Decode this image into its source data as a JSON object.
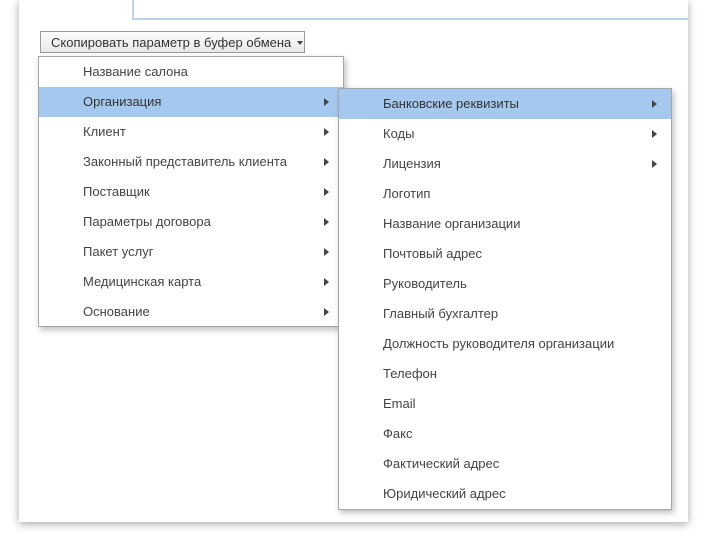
{
  "toolbar": {
    "copy_button_label": "Скопировать параметр в буфер обмена"
  },
  "main_menu": {
    "items": [
      {
        "label": "Название салона",
        "has_submenu": false,
        "highlighted": false
      },
      {
        "label": "Организация",
        "has_submenu": true,
        "highlighted": true
      },
      {
        "label": "Клиент",
        "has_submenu": true,
        "highlighted": false
      },
      {
        "label": "Законный представитель клиента",
        "has_submenu": true,
        "highlighted": false
      },
      {
        "label": "Поставщик",
        "has_submenu": true,
        "highlighted": false
      },
      {
        "label": "Параметры договора",
        "has_submenu": true,
        "highlighted": false
      },
      {
        "label": "Пакет услуг",
        "has_submenu": true,
        "highlighted": false
      },
      {
        "label": "Медицинская карта",
        "has_submenu": true,
        "highlighted": false
      },
      {
        "label": "Основание",
        "has_submenu": true,
        "highlighted": false
      }
    ]
  },
  "sub_menu": {
    "items": [
      {
        "label": "Банковские реквизиты",
        "has_submenu": true,
        "highlighted": true
      },
      {
        "label": "Коды",
        "has_submenu": true,
        "highlighted": false
      },
      {
        "label": "Лицензия",
        "has_submenu": true,
        "highlighted": false
      },
      {
        "label": "Логотип",
        "has_submenu": false,
        "highlighted": false
      },
      {
        "label": "Название организации",
        "has_submenu": false,
        "highlighted": false
      },
      {
        "label": "Почтовый адрес",
        "has_submenu": false,
        "highlighted": false
      },
      {
        "label": "Руководитель",
        "has_submenu": false,
        "highlighted": false
      },
      {
        "label": "Главный бухгалтер",
        "has_submenu": false,
        "highlighted": false
      },
      {
        "label": "Должность руководителя организации",
        "has_submenu": false,
        "highlighted": false
      },
      {
        "label": "Телефон",
        "has_submenu": false,
        "highlighted": false
      },
      {
        "label": "Email",
        "has_submenu": false,
        "highlighted": false
      },
      {
        "label": "Факс",
        "has_submenu": false,
        "highlighted": false
      },
      {
        "label": "Фактический адрес",
        "has_submenu": false,
        "highlighted": false
      },
      {
        "label": "Юридический адрес",
        "has_submenu": false,
        "highlighted": false
      }
    ]
  },
  "colors": {
    "highlight": "#a5c9ee",
    "field_border": "#b9d3ec"
  },
  "icons": {
    "dropdown": "chevron-down-icon",
    "submenu": "chevron-right-icon"
  }
}
